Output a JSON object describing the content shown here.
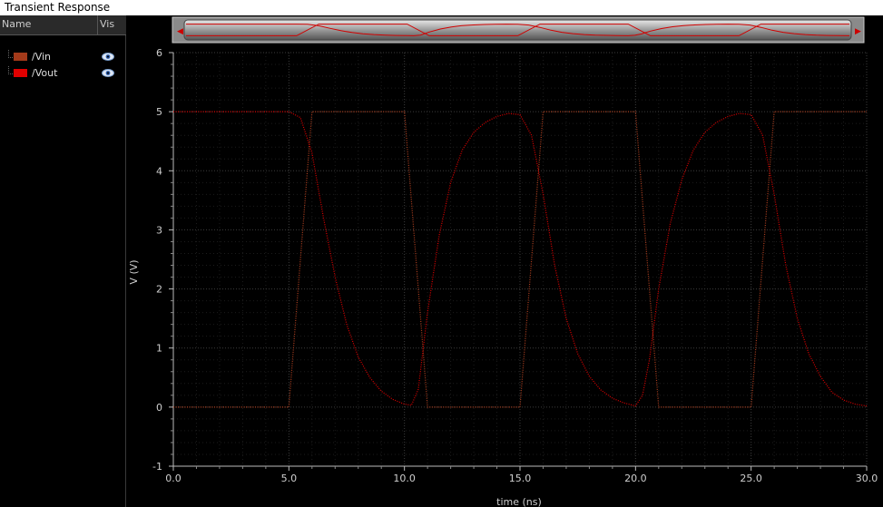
{
  "window": {
    "title": "Transient Response"
  },
  "legend": {
    "header_name": "Name",
    "header_vis": "Vis",
    "items": [
      {
        "label": "/Vin",
        "color": "#a33a1a",
        "visible": true
      },
      {
        "label": "/Vout",
        "color": "#e00000",
        "visible": true
      }
    ]
  },
  "scrollbar": {
    "left_arrow": "◀",
    "right_arrow": "▶"
  },
  "chart_data": {
    "type": "line",
    "xlabel": "time (ns)",
    "ylabel": "V (V)",
    "xlim": [
      0,
      30
    ],
    "ylim": [
      -1,
      6
    ],
    "x_ticks": [
      "0.0",
      "5.0",
      "10.0",
      "15.0",
      "20.0",
      "25.0",
      "30.0"
    ],
    "y_ticks": [
      "-1",
      "0",
      "1",
      "2",
      "3",
      "4",
      "5",
      "6"
    ],
    "grid": true,
    "series": [
      {
        "name": "/Vin",
        "color": "#b04020",
        "x": [
          0,
          5,
          6,
          10,
          11,
          15,
          16,
          20,
          21,
          25,
          26,
          30
        ],
        "y": [
          0,
          0,
          5,
          5,
          0,
          0,
          5,
          5,
          0,
          0,
          5,
          5
        ]
      },
      {
        "name": "/Vout",
        "color": "#e00000",
        "x": [
          0,
          5,
          5.5,
          6,
          6.5,
          7,
          7.5,
          8,
          8.5,
          9,
          9.5,
          10,
          10.3,
          10.6,
          11,
          11.5,
          12,
          12.5,
          13,
          13.5,
          14,
          14.5,
          15,
          15.5,
          16,
          16.5,
          17,
          17.5,
          18,
          18.5,
          19,
          19.5,
          20,
          20.3,
          20.6,
          21,
          21.5,
          22,
          22.5,
          23,
          23.5,
          24,
          24.5,
          25,
          25.5,
          26,
          26.5,
          27,
          27.5,
          28,
          28.5,
          29,
          29.5,
          30
        ],
        "y": [
          5,
          5,
          4.9,
          4.3,
          3.2,
          2.2,
          1.4,
          0.85,
          0.5,
          0.27,
          0.13,
          0.05,
          0.03,
          0.3,
          1.6,
          2.9,
          3.8,
          4.35,
          4.65,
          4.82,
          4.92,
          4.97,
          4.95,
          4.6,
          3.6,
          2.4,
          1.5,
          0.9,
          0.52,
          0.29,
          0.15,
          0.07,
          0.02,
          0.2,
          0.8,
          2.0,
          3.1,
          3.85,
          4.35,
          4.65,
          4.82,
          4.92,
          4.97,
          4.95,
          4.6,
          3.6,
          2.4,
          1.5,
          0.9,
          0.52,
          0.25,
          0.12,
          0.05,
          0.02
        ]
      }
    ]
  }
}
